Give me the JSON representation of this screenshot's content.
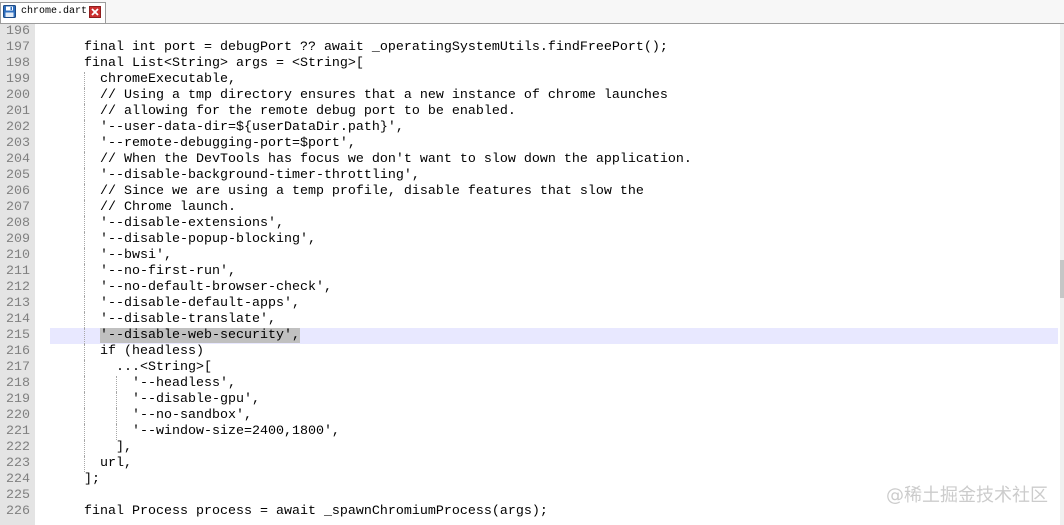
{
  "tabs": [
    {
      "label": "chrome.dart",
      "icon": "save-icon",
      "close_icon": "close-icon"
    }
  ],
  "colors": {
    "gutter_bg": "#e4e4e4",
    "line_number_text": "#808080",
    "current_line_bg": "#e8e8ff",
    "selection_bg": "#c0c0c0",
    "code_text": "#000000",
    "indent_guide": "#a8a8a8",
    "save_icon": "#2f6fbf",
    "close_icon": "#cc2f2f"
  },
  "editor": {
    "current_line": "215",
    "lines": [
      {
        "number": "196",
        "text": ""
      },
      {
        "number": "197",
        "text": "    final int port = debugPort ?? await _operatingSystemUtils.findFreePort();"
      },
      {
        "number": "198",
        "text": "    final List<String> args = <String>["
      },
      {
        "number": "199",
        "text": "      chromeExecutable,"
      },
      {
        "number": "200",
        "text": "      // Using a tmp directory ensures that a new instance of chrome launches"
      },
      {
        "number": "201",
        "text": "      // allowing for the remote debug port to be enabled."
      },
      {
        "number": "202",
        "text": "      '--user-data-dir=${userDataDir.path}',"
      },
      {
        "number": "203",
        "text": "      '--remote-debugging-port=$port',"
      },
      {
        "number": "204",
        "text": "      // When the DevTools has focus we don't want to slow down the application."
      },
      {
        "number": "205",
        "text": "      '--disable-background-timer-throttling',"
      },
      {
        "number": "206",
        "text": "      // Since we are using a temp profile, disable features that slow the"
      },
      {
        "number": "207",
        "text": "      // Chrome launch."
      },
      {
        "number": "208",
        "text": "      '--disable-extensions',"
      },
      {
        "number": "209",
        "text": "      '--disable-popup-blocking',"
      },
      {
        "number": "210",
        "text": "      '--bwsi',"
      },
      {
        "number": "211",
        "text": "      '--no-first-run',"
      },
      {
        "number": "212",
        "text": "      '--no-default-browser-check',"
      },
      {
        "number": "213",
        "text": "      '--disable-default-apps',"
      },
      {
        "number": "214",
        "text": "      '--disable-translate',"
      },
      {
        "number": "215",
        "text": "      ",
        "selected": "'--disable-web-security',"
      },
      {
        "number": "216",
        "text": "      if (headless)"
      },
      {
        "number": "217",
        "text": "        ...<String>["
      },
      {
        "number": "218",
        "text": "          '--headless',"
      },
      {
        "number": "219",
        "text": "          '--disable-gpu',"
      },
      {
        "number": "220",
        "text": "          '--no-sandbox',"
      },
      {
        "number": "221",
        "text": "          '--window-size=2400,1800',"
      },
      {
        "number": "222",
        "text": "        ],"
      },
      {
        "number": "223",
        "text": "      url,"
      },
      {
        "number": "224",
        "text": "    ];"
      },
      {
        "number": "225",
        "text": ""
      },
      {
        "number": "226",
        "text": "    final Process process = await _spawnChromiumProcess(args);"
      }
    ]
  },
  "vertical_scrollbar": {
    "position": 0.51
  },
  "watermark": "@稀土掘金技术社区"
}
